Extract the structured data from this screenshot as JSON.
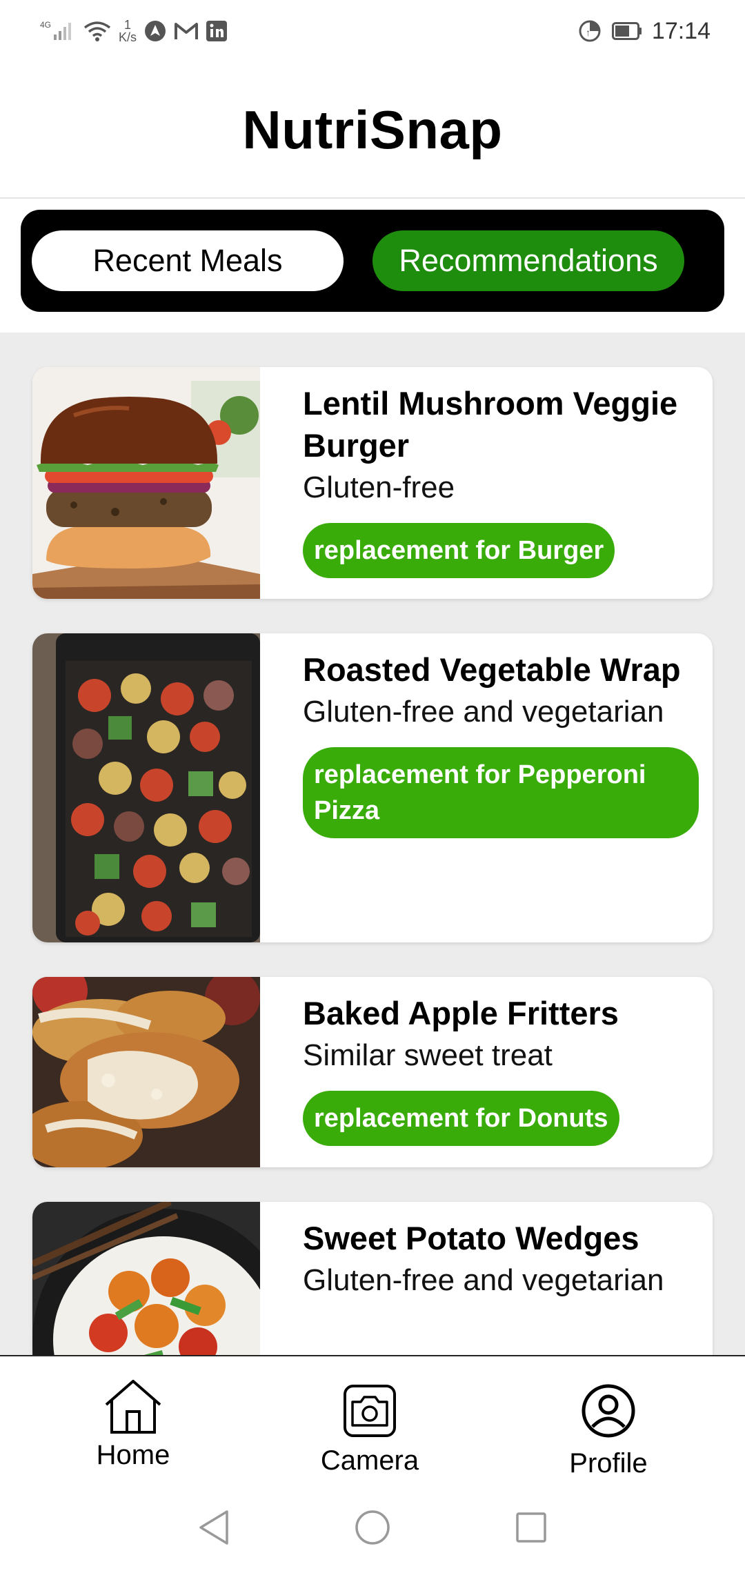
{
  "status_bar": {
    "network": "4G",
    "speed_value": "1",
    "speed_unit": "K/s",
    "time": "17:14"
  },
  "app": {
    "title": "NutriSnap"
  },
  "tabs": [
    {
      "label": "Recent Meals",
      "active": false
    },
    {
      "label": "Recommendations",
      "active": true
    }
  ],
  "recommendations": [
    {
      "title": "Lentil Mushroom Veggie Burger",
      "subtitle": "Gluten-free",
      "badge": "replacement for Burger",
      "image_icon": "burger-photo"
    },
    {
      "title": "Roasted Vegetable Wrap",
      "subtitle": "Gluten-free and vegetarian",
      "badge": "replacement for Pepperoni Pizza",
      "image_icon": "roasted-vegetables-photo"
    },
    {
      "title": "Baked Apple Fritters",
      "subtitle": "Similar sweet treat",
      "badge": "replacement for Donuts",
      "image_icon": "apple-fritters-photo"
    },
    {
      "title": "Sweet Potato Wedges",
      "subtitle": "Gluten-free and vegetarian",
      "badge": "",
      "image_icon": "stir-fry-photo"
    }
  ],
  "bottom_nav": [
    {
      "label": "Home",
      "icon": "home-icon"
    },
    {
      "label": "Camera",
      "icon": "camera-icon"
    },
    {
      "label": "Profile",
      "icon": "profile-icon"
    }
  ],
  "colors": {
    "active_tab": "#1e8c0c",
    "badge": "#39ac0a",
    "tab_bar": "#000000",
    "list_background": "#ececec"
  }
}
